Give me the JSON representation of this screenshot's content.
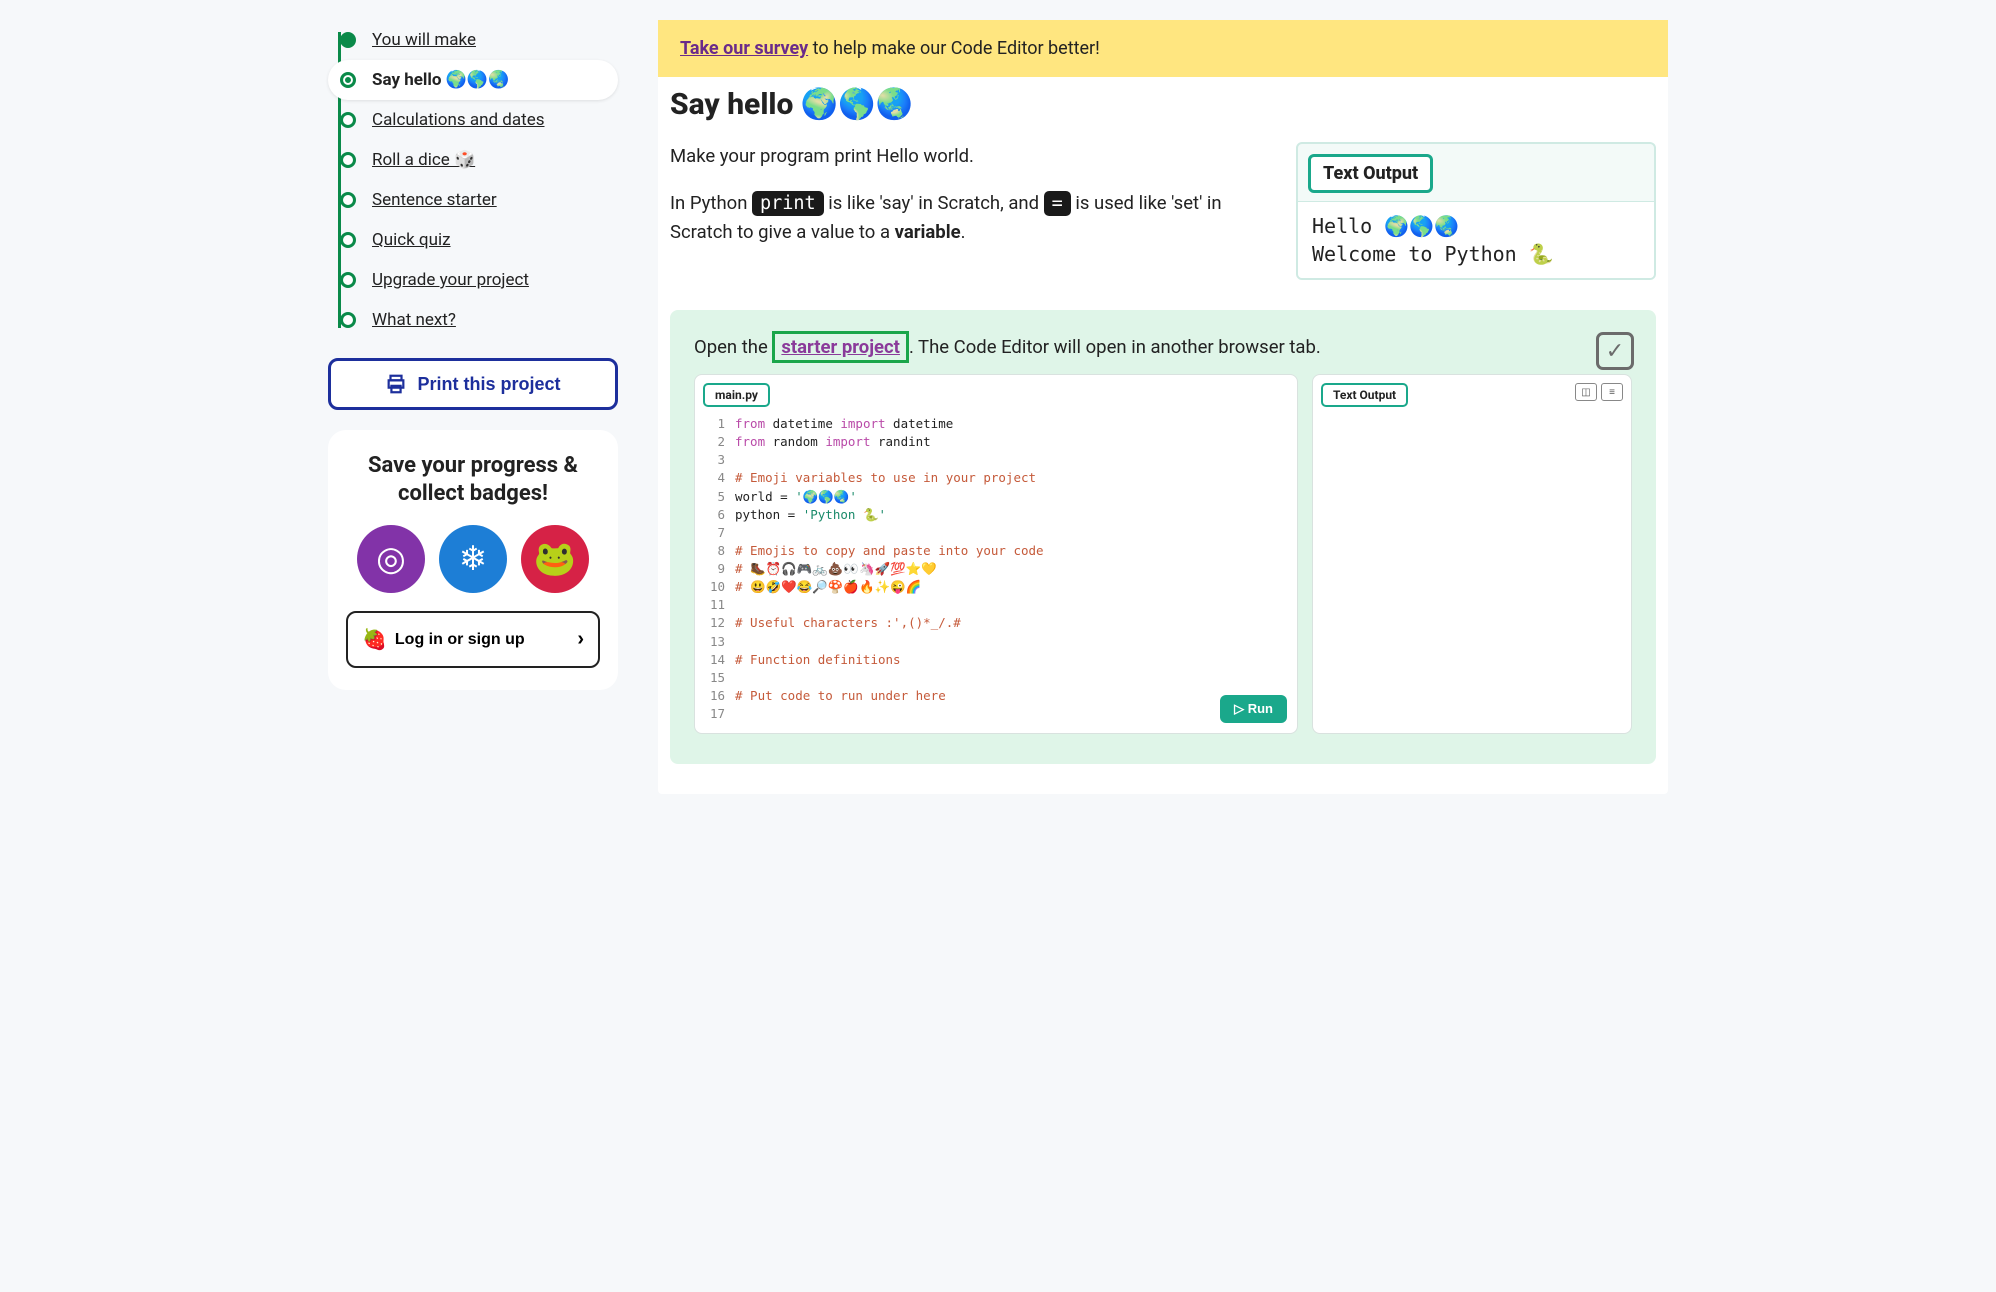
{
  "sidebar": {
    "steps": [
      {
        "label": "You will make"
      },
      {
        "label": "Say hello 🌍🌎🌏"
      },
      {
        "label": "Calculations and dates"
      },
      {
        "label": "Roll a dice 🎲"
      },
      {
        "label": "Sentence starter"
      },
      {
        "label": "Quick quiz"
      },
      {
        "label": "Upgrade your project"
      },
      {
        "label": "What next?"
      }
    ],
    "print_label": "Print this project",
    "progress_title": "Save your progress & collect badges!",
    "login_label": "Log in or sign up"
  },
  "survey": {
    "link_text": "Take our survey",
    "rest": " to help make our Code Editor better!"
  },
  "heading": "Say hello 🌍🌎🌏",
  "intro": {
    "p1": "Make your program print Hello world.",
    "p2a": "In Python ",
    "print_chip": "print",
    "p2b": " is like 'say' in Scratch, and ",
    "eq_chip": "=",
    "p2c": " is used like 'set' in Scratch to give a value to a ",
    "variable_word": "variable",
    "p2d": "."
  },
  "output_preview": {
    "label": "Text Output",
    "line1": "Hello 🌍🌎🌏",
    "line2": "Welcome to Python 🐍"
  },
  "panel": {
    "open_a": "Open the ",
    "link": "starter project",
    "open_b": ". The Code Editor will open in another browser tab."
  },
  "editor": {
    "filename": "main.py",
    "text_output_tab": "Text Output",
    "run_label": "▷  Run",
    "lines": [
      {
        "n": "1",
        "h": "<span class='kw'>from</span> datetime <span class='kw'>import</span> datetime"
      },
      {
        "n": "2",
        "h": "<span class='kw'>from</span> random <span class='kw'>import</span> randint"
      },
      {
        "n": "3",
        "h": ""
      },
      {
        "n": "4",
        "h": "<span class='cm'># Emoji variables to use in your project</span>"
      },
      {
        "n": "5",
        "h": "world = <span class='str'>'🌍🌎🌏'</span>"
      },
      {
        "n": "6",
        "h": "python = <span class='str'>'Python 🐍'</span>"
      },
      {
        "n": "7",
        "h": ""
      },
      {
        "n": "8",
        "h": "<span class='cm'># Emojis to copy and paste into your code</span>"
      },
      {
        "n": "9",
        "h": "<span class='cm'># 🥾⏰🎧🎮🚲💩👀🦄🚀💯⭐💛</span>"
      },
      {
        "n": "10",
        "h": "<span class='cm'># 😃🤣❤️😂🔎🍄🍎🔥✨😜🌈</span>"
      },
      {
        "n": "11",
        "h": ""
      },
      {
        "n": "12",
        "h": "<span class='cm'># Useful characters :',()*_/.#</span>"
      },
      {
        "n": "13",
        "h": ""
      },
      {
        "n": "14",
        "h": "<span class='cm'># Function definitions</span>"
      },
      {
        "n": "15",
        "h": ""
      },
      {
        "n": "16",
        "h": "<span class='cm'># Put code to run under here</span>"
      },
      {
        "n": "17",
        "h": ""
      }
    ]
  }
}
